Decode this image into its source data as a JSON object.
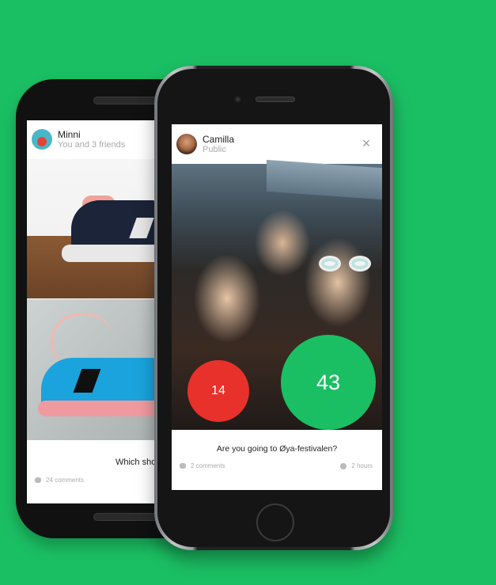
{
  "back_post": {
    "user": "Minni",
    "audience": "You and 3 friends",
    "caption": "Which should",
    "comments": "24 comments"
  },
  "front_post": {
    "user": "Camilla",
    "audience": "Public",
    "close_icon": "×",
    "question": "Are you going to Øya-festivalen?",
    "comments": "2 comments",
    "time": "2 hours",
    "votes": {
      "no": "14",
      "yes": "43"
    }
  },
  "colors": {
    "background": "#1bbf63",
    "vote_no": "#e8312a",
    "vote_yes": "#1bbf63"
  }
}
